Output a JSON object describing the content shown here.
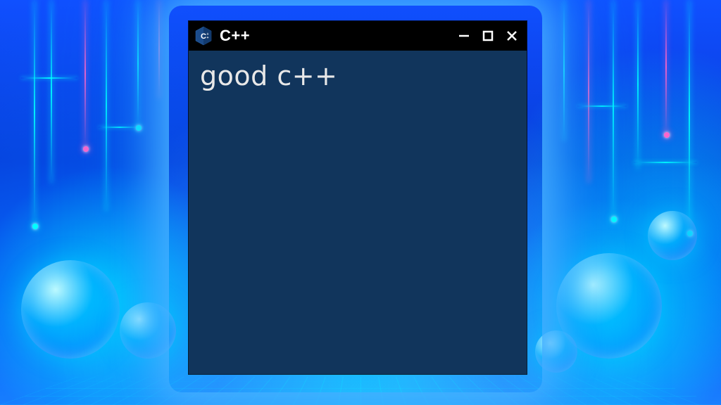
{
  "window": {
    "title": "C++",
    "icon_name": "cpp-hexagon-icon"
  },
  "controls": {
    "minimize": "minimize",
    "maximize": "maximize",
    "close": "close"
  },
  "console": {
    "output": "good c++"
  },
  "colors": {
    "titlebar_bg": "#000000",
    "content_bg": "#11355c",
    "text": "#e8e8e8",
    "accent_cyan": "#00e0ff",
    "accent_pink": "#ff66cc"
  }
}
